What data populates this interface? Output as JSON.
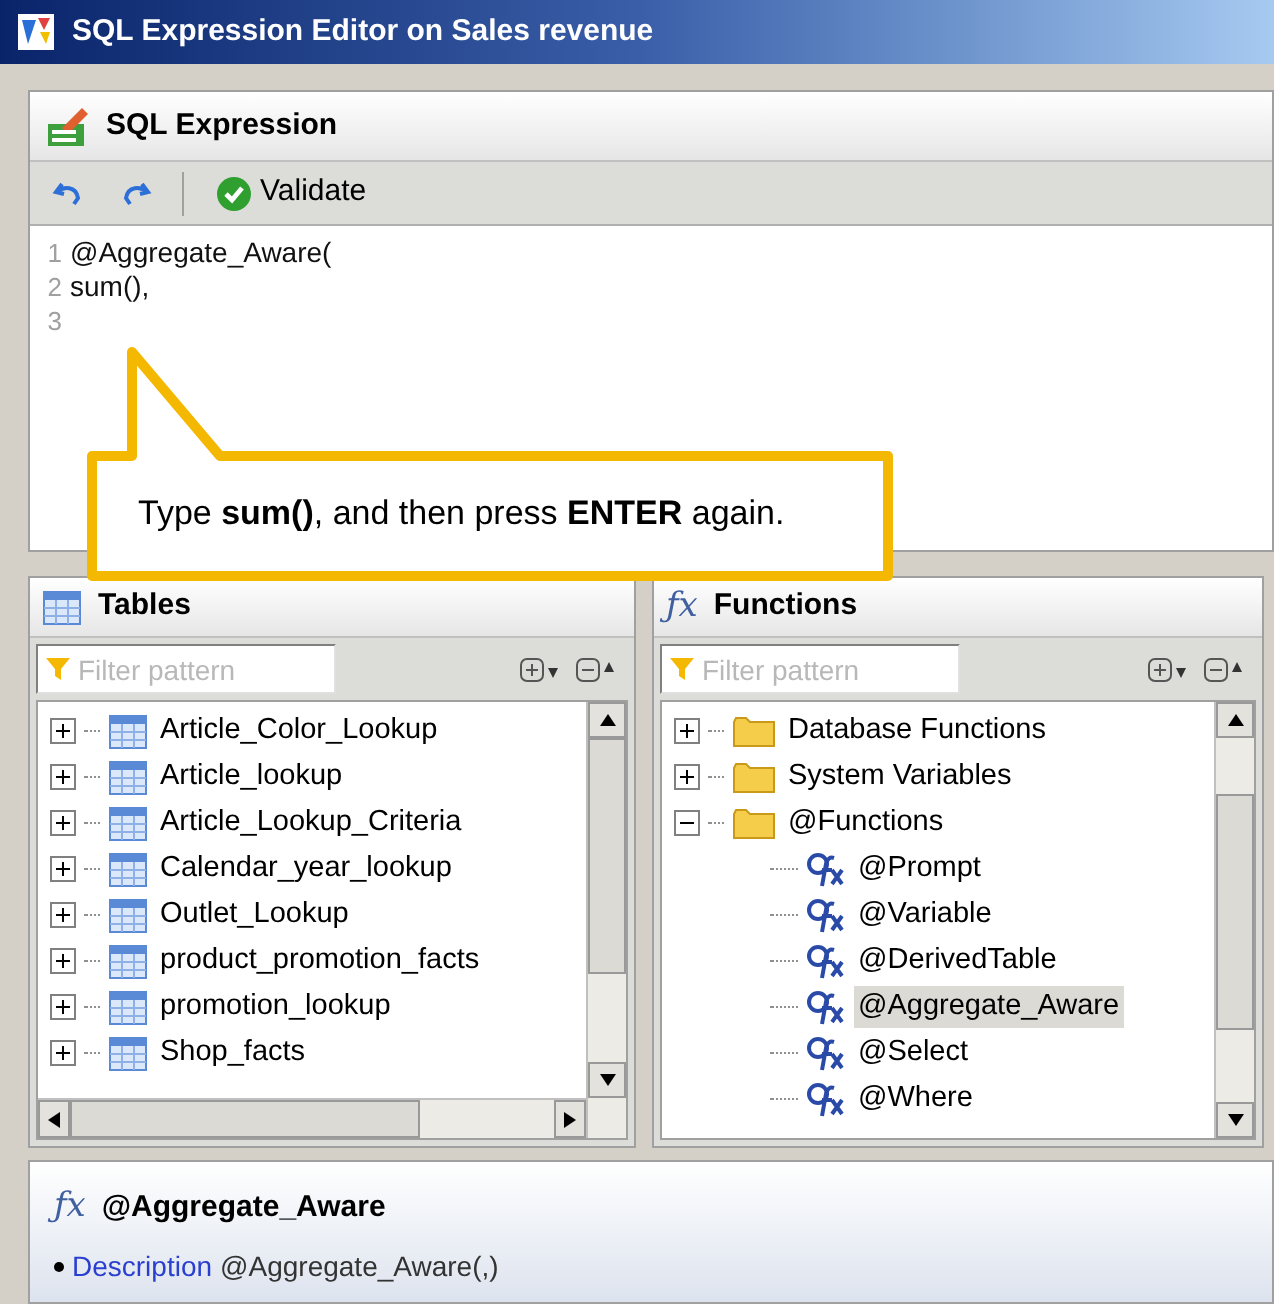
{
  "window": {
    "title": "SQL Expression Editor on Sales revenue"
  },
  "editor": {
    "title": "SQL Expression",
    "validate_label": "Validate",
    "lines": [
      {
        "number": "1",
        "text": "@Aggregate_Aware("
      },
      {
        "number": "2",
        "text": "sum(),"
      },
      {
        "number": "3"
      }
    ]
  },
  "callout": {
    "text": "Type **sum()**, and then press **ENTER** again."
  },
  "panels": [
    {
      "kind": "tables",
      "title": "Tables",
      "placeholder": "Filter pattern",
      "items": [
        {
          "label": "Article_Color_Lookup",
          "kind": "table",
          "expanded": false
        },
        {
          "label": "Article_lookup",
          "kind": "table",
          "expanded": false
        },
        {
          "label": "Article_Lookup_Criteria",
          "kind": "table",
          "expanded": false
        },
        {
          "label": "Calendar_year_lookup",
          "kind": "table",
          "expanded": false
        },
        {
          "label": "Outlet_Lookup",
          "kind": "table",
          "expanded": false
        },
        {
          "label": "product_promotion_facts",
          "kind": "table",
          "expanded": false
        },
        {
          "label": "promotion_lookup",
          "kind": "table",
          "expanded": false
        },
        {
          "label": "Shop_facts",
          "kind": "table",
          "expanded": false
        }
      ]
    },
    {
      "kind": "functions",
      "icon": "ƒx",
      "title": "Functions",
      "placeholder": "Filter pattern",
      "items": [
        {
          "label": "Database Functions",
          "kind": "folder",
          "expanded": false
        },
        {
          "label": "System Variables",
          "kind": "folder",
          "expanded": false
        },
        {
          "label": "@Functions",
          "kind": "folder",
          "expanded": true,
          "children": [
            {
              "label": "@Prompt",
              "kind": "function",
              "selected": false
            },
            {
              "label": "@Variable",
              "kind": "function",
              "selected": false
            },
            {
              "label": "@DerivedTable",
              "kind": "function",
              "selected": false
            },
            {
              "label": "@Aggregate_Aware",
              "kind": "function",
              "selected": true
            },
            {
              "label": "@Select",
              "kind": "function",
              "selected": false
            },
            {
              "label": "@Where",
              "kind": "function",
              "selected": false
            }
          ]
        }
      ]
    }
  ],
  "details": {
    "icon": "ƒx",
    "title": "@Aggregate_Aware",
    "description_label": "Description",
    "description": "@Aggregate_Aware(,)"
  }
}
